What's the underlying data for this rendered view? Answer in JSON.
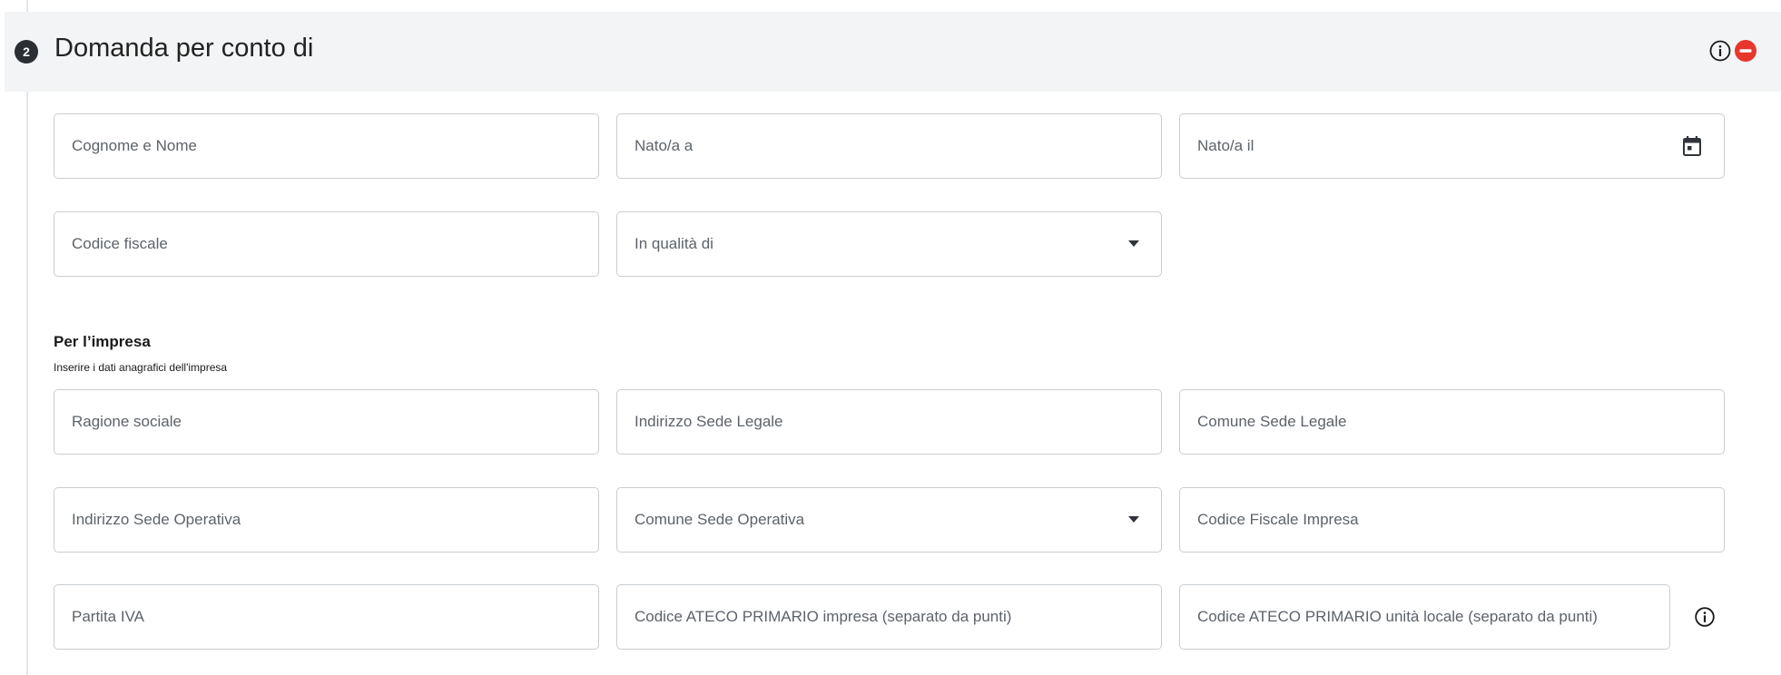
{
  "section": {
    "step": "2",
    "title": "Domanda per conto di",
    "info_icon": "info-circle-icon",
    "remove_icon": "minus-circle-icon",
    "remove_color": "#e8362d"
  },
  "applicant": {
    "full_name": {
      "placeholder": "Cognome e Nome",
      "value": ""
    },
    "birth_place": {
      "placeholder": "Nato/a a",
      "value": ""
    },
    "birth_date": {
      "placeholder": "Nato/a il",
      "value": "",
      "icon": "calendar-icon"
    },
    "tax_code": {
      "placeholder": "Codice fiscale",
      "value": ""
    },
    "role": {
      "placeholder": "In qualità di",
      "value": "",
      "icon": "caret-down-icon"
    }
  },
  "company_section": {
    "title": "Per l’impresa",
    "hint": "Inserire i dati anagrafici dell'impresa"
  },
  "company": {
    "name": {
      "placeholder": "Ragione sociale",
      "value": ""
    },
    "legal_address": {
      "placeholder": "Indirizzo Sede Legale",
      "value": ""
    },
    "legal_city": {
      "placeholder": "Comune Sede Legale",
      "value": ""
    },
    "operating_address": {
      "placeholder": "Indirizzo Sede Operativa",
      "value": ""
    },
    "operating_city": {
      "placeholder": "Comune Sede Operativa",
      "value": "",
      "icon": "caret-down-icon"
    },
    "company_tax_code": {
      "placeholder": "Codice Fiscale Impresa",
      "value": ""
    },
    "vat_number": {
      "placeholder": "Partita IVA",
      "value": ""
    },
    "ateco_company": {
      "placeholder": "Codice ATECO PRIMARIO impresa (separato da punti)",
      "value": ""
    },
    "ateco_local_unit": {
      "placeholder": "Codice ATECO PRIMARIO unità locale (separato da punti)",
      "value": "",
      "info_icon": "info-circle-icon"
    }
  }
}
